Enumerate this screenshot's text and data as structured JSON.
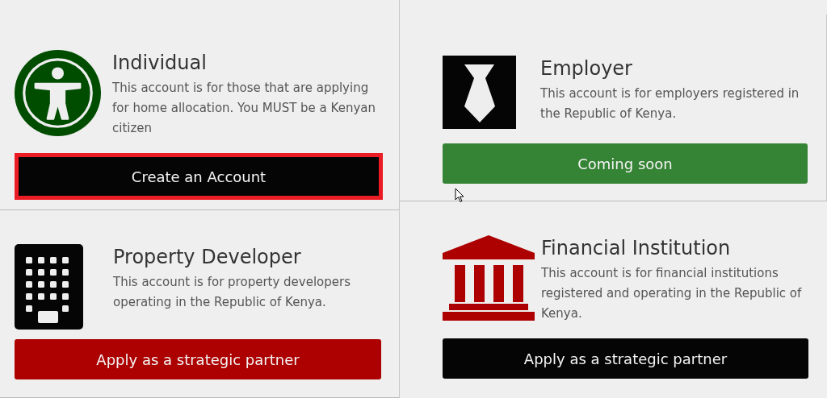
{
  "columns": [
    {
      "cards": [
        {
          "kind": "person",
          "title": "Individual",
          "description": "This account is for those that are applying for home allocation. You MUST be a Kenyan citizen",
          "button": {
            "label": "Create an Account",
            "kind": "black",
            "highlighted": true
          }
        },
        {
          "kind": "building",
          "title": "Property Developer",
          "description": "This account is for property developers operating in the Republic of Kenya.",
          "button": {
            "label": "Apply as a strategic partner",
            "kind": "red",
            "highlighted": false
          }
        }
      ]
    },
    {
      "cards": [
        {
          "kind": "tie",
          "title": "Employer",
          "description": "This account is for employers registered in the Republic of Kenya.",
          "button": {
            "label": "Coming soon",
            "kind": "green",
            "highlighted": false
          }
        },
        {
          "kind": "bank",
          "title": "Financial Institution",
          "description": "This account is for financial institutions registered and operating in the Republic of Kenya.",
          "button": {
            "label": "Apply as a strategic partner",
            "kind": "black",
            "highlighted": false
          }
        }
      ]
    }
  ]
}
